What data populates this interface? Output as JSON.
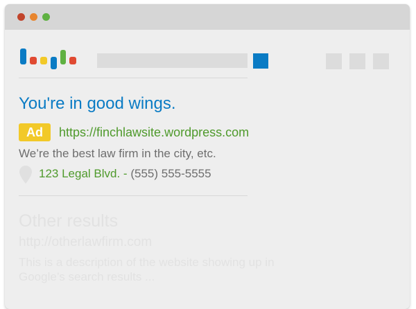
{
  "colors": {
    "brand_blue": "#0a7bc4",
    "ad_badge": "#f2c928",
    "link_green": "#4f9a2c",
    "text_gray": "#6e6e6e",
    "faded_text": "#e2e2e2",
    "logo": [
      "#0a7bc4",
      "#e04a32",
      "#f2c928",
      "#0a7bc4",
      "#5fb142",
      "#e04a32"
    ]
  },
  "window_controls": [
    "close-dot",
    "minimize-dot",
    "maximize-dot"
  ],
  "ad": {
    "title": "You're in good wings.",
    "badge": "Ad",
    "url": "https://finchlawsite.wordpress.com",
    "description": "We’re the best law firm in the city, etc.",
    "address": "123 Legal Blvd. -",
    "phone": "(555) 555-5555",
    "location_icon": "map-pin-icon"
  },
  "other_result": {
    "title": "Other results",
    "url": "http://otherlawfirm.com",
    "description": "This is a description of the website showing up in Google’s search results ..."
  }
}
